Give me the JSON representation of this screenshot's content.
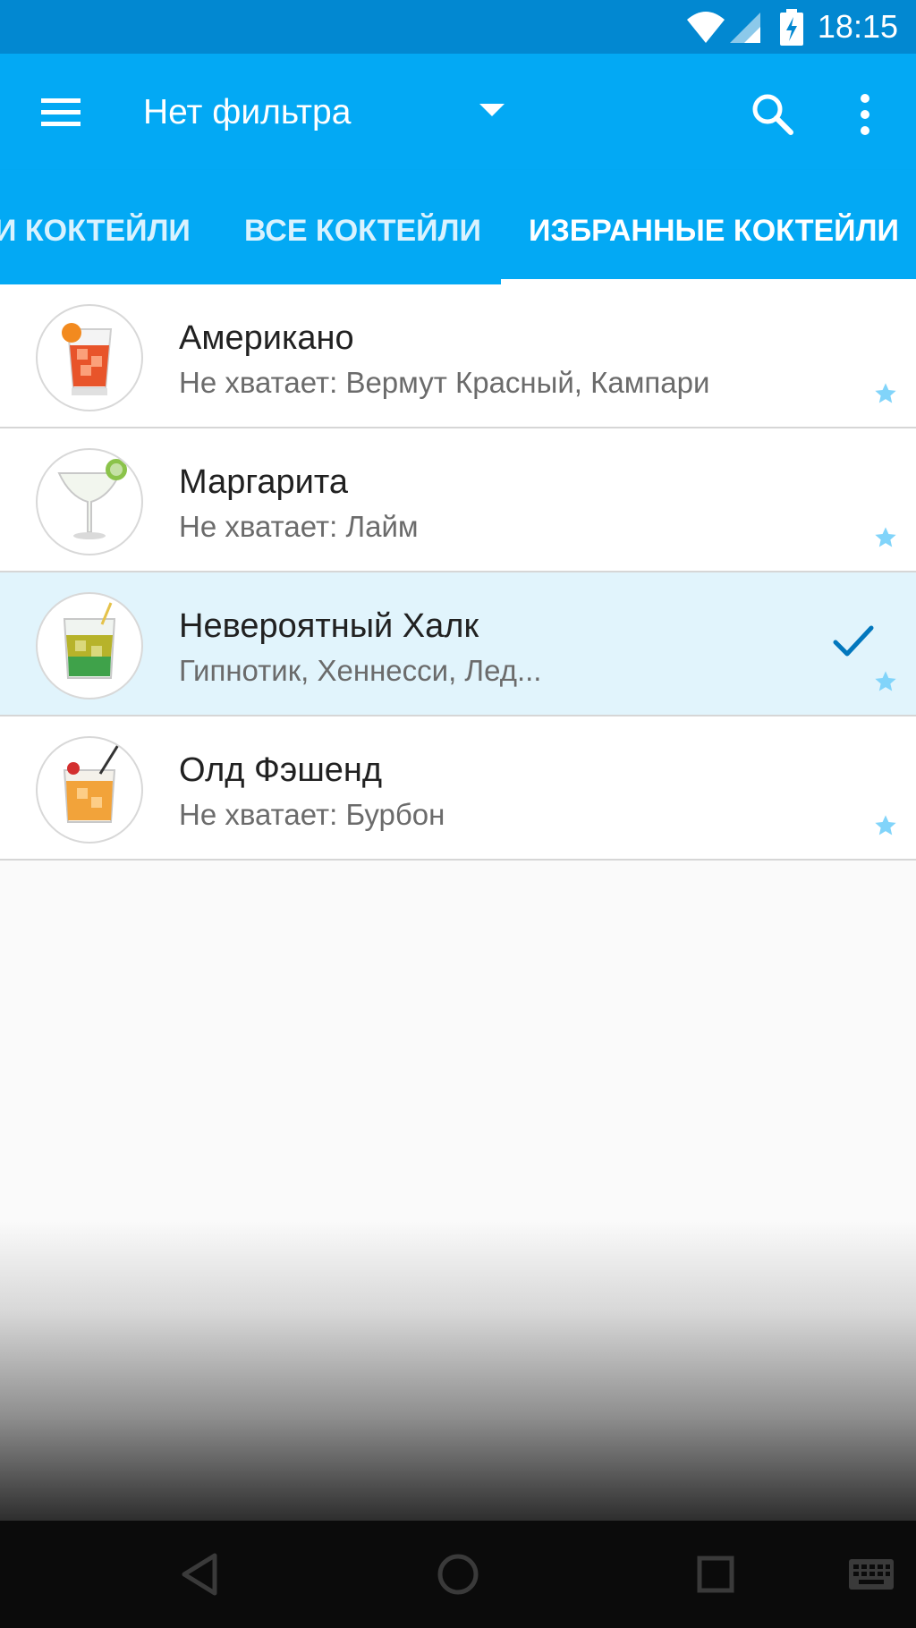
{
  "status_bar": {
    "time": "18:15",
    "icons": [
      "wifi-icon",
      "signal-icon",
      "battery-charging-icon"
    ]
  },
  "toolbar": {
    "menu_icon": "hamburger-menu-icon",
    "filter_label": "Нет фильтра",
    "dropdown_icon": "dropdown-arrow-icon",
    "search_icon": "search-icon",
    "more_icon": "more-vert-icon"
  },
  "tabs": [
    {
      "label": "И КОКТЕЙЛИ",
      "active": false
    },
    {
      "label": "ВСЕ КОКТЕЙЛИ",
      "active": false
    },
    {
      "label": "ИЗБРАННЫЕ КОКТЕЙЛИ",
      "active": true
    }
  ],
  "cocktails": [
    {
      "name": "Американо",
      "subtitle": "Не хватает: Вермут Красный, Кампари",
      "selected": false,
      "favorite": true
    },
    {
      "name": "Маргарита",
      "subtitle": "Не хватает: Лайм",
      "selected": false,
      "favorite": true
    },
    {
      "name": "Невероятный Халк",
      "subtitle": "Гипнотик, Хеннесси, Лед...",
      "selected": true,
      "favorite": true
    },
    {
      "name": "Олд Фэшенд",
      "subtitle": "Не хватает: Бурбон",
      "selected": false,
      "favorite": true
    }
  ],
  "nav_bar": {
    "icons": [
      "back-icon",
      "home-icon",
      "recents-icon",
      "keyboard-icon"
    ]
  },
  "colors": {
    "toolbar": "#03a9f4",
    "status_bar": "#0288d1",
    "selected_row": "#e1f4fc",
    "star": "#81d4fa",
    "check": "#0277bd"
  }
}
